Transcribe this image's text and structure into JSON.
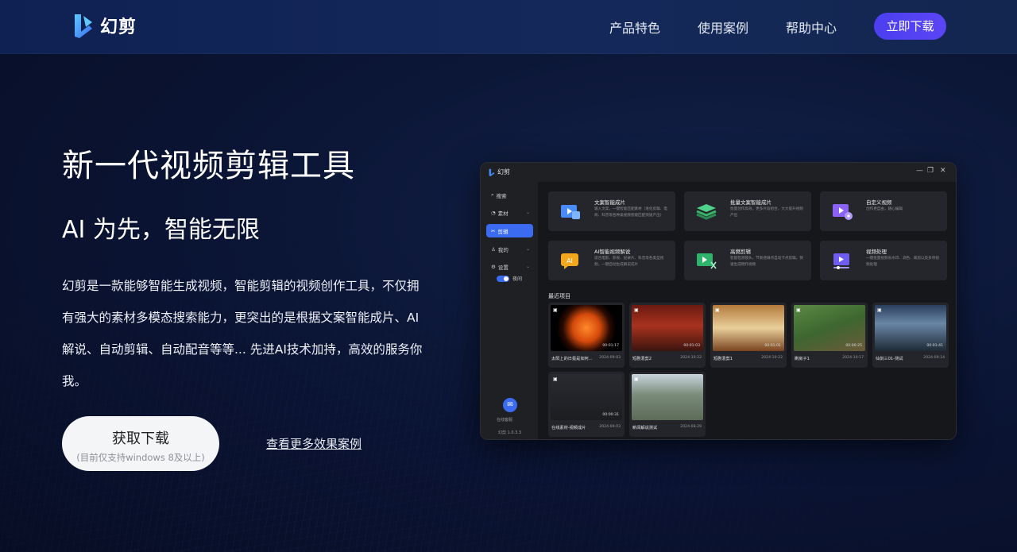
{
  "nav": {
    "logo_text": "幻剪",
    "links": [
      "产品特色",
      "使用案例",
      "帮助中心"
    ],
    "download_btn": "立即下载"
  },
  "hero": {
    "title": "新一代视频剪辑工具",
    "subtitle": "AI 为先，智能无限",
    "description": "幻剪是一款能够智能生成视频，智能剪辑的视频创作工具，不仅拥有强大的素材多模态搜索能力，更突出的是根据文案智能成片、AI解说、自动剪辑、自动配音等等... 先进AI技术加持，高效的服务你我。",
    "download_main": "获取下载",
    "download_note": "(目前仅支持windows 8及以上)",
    "more_link": "查看更多效果案例"
  },
  "app": {
    "title": "幻剪",
    "window_controls": [
      "—",
      "❐",
      "✕"
    ],
    "sidebar": {
      "items": [
        {
          "icon": "search-icon",
          "label": "搜索"
        },
        {
          "icon": "material-icon",
          "label": "素材"
        },
        {
          "icon": "scissors-icon",
          "label": "剪辑"
        },
        {
          "icon": "user-icon",
          "label": "我的"
        },
        {
          "icon": "gear-icon",
          "label": "设置"
        }
      ],
      "toggle_label": "夜间",
      "help_label": "在线客服",
      "version": "幻剪 1.0.3.3"
    },
    "features": [
      {
        "title": "文案智能成片",
        "desc": "输入文案，一键智能匹配素材（进化剪辑、电商、科普等各种类视频智能匹配快速产出）",
        "icon_color": "#4a8cf7"
      },
      {
        "title": "批量文案智能成片",
        "desc": "批量创作高效，更多片段组合，大大提升视频产出",
        "icon_color": "#37b46a"
      },
      {
        "title": "自定义视频",
        "desc": "创作更自由，随心编辑",
        "icon_color": "#8a63f5"
      },
      {
        "title": "AI智能视频解说",
        "desc": "适合电影、影视、纪录片、科普等各类型视频，一键自动生成解说成片",
        "icon_color": "#f3a71c"
      },
      {
        "title": "高燃剪辑",
        "desc": "智能检测镜头，节奏感踩点自动卡点剪辑，快速生成燃炸视频",
        "icon_color": "#2fb36c"
      },
      {
        "title": "视频处理",
        "desc": "一键批量视频去水印、调色、裁剪以及多项视频处理",
        "icon_color": "#6f5cf0"
      }
    ],
    "recent_title": "最近项目",
    "recent": [
      {
        "name": "太阳上的日冕是如何...",
        "date": "2024-09-03",
        "duration": "00:01:17",
        "bg": "radial-gradient(circle at 50% 50%, #ff8a2a 0%, #d64a0c 32%, #2a0a02 55%, #000 70%)"
      },
      {
        "name": "短剧混剪2",
        "date": "2024-10-22",
        "duration": "00:01:03",
        "bg": "linear-gradient(180deg, #6b1a12 0%, #a8321e 45%, #3c1410 100%)"
      },
      {
        "name": "短剧混剪1",
        "date": "2024-10-22",
        "duration": "00:01:01",
        "bg": "linear-gradient(180deg, #b47a3c 0%, #e9cf9a 50%, #7a4420 100%)"
      },
      {
        "name": "刷房子1",
        "date": "2024-10-17",
        "duration": "00:00:25",
        "bg": "linear-gradient(160deg, #5a8a44 0%, #3e6630 50%, #6b5a3a 100%)"
      },
      {
        "name": "仙剑三01-测试",
        "date": "2024-09-14",
        "duration": "00:01:41",
        "bg": "linear-gradient(180deg, #2a3e5c 0%, #6a86a6 40%, #1e2a36 100%)"
      },
      {
        "name": "在线素材-视频成片",
        "date": "2024-09-03",
        "duration": "00:00:31",
        "bg": "linear-gradient(180deg, #2a2b30 0%, #1c1d21 100%)"
      },
      {
        "name": "新闻解说测试",
        "date": "2024-08-29",
        "duration": "",
        "bg": "linear-gradient(180deg, #c8d4dc 0%, #7a8c7a 45%, #5d6a58 100%)"
      }
    ]
  }
}
